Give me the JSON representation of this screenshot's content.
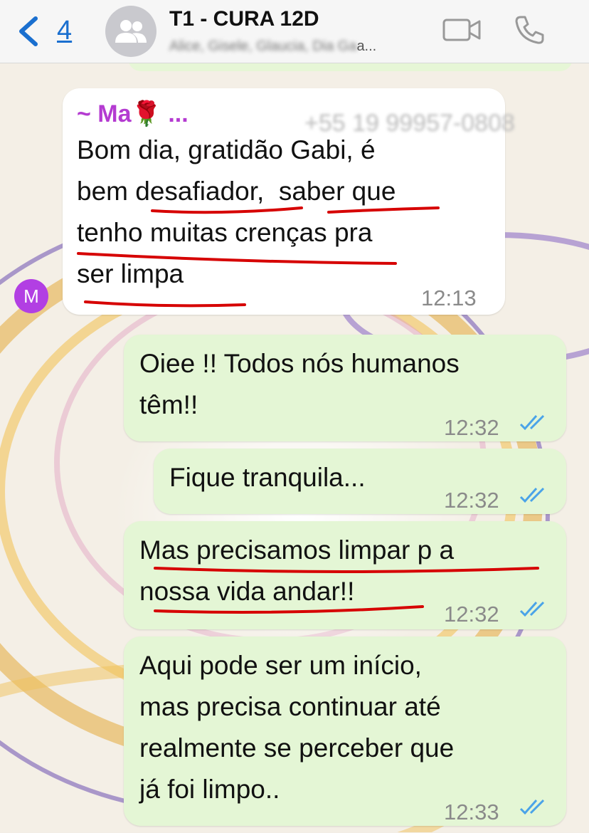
{
  "header": {
    "back_count": "4",
    "title": "T1 - CURA 12D",
    "subtitle_visible": "a...",
    "subtitle_blurred": "Alice, Gisele, Glaucia, Dia Ga"
  },
  "messages": [
    {
      "sender": "~ Ma🌹 ...",
      "sender_phone": "+55 19 99957-0808",
      "lines": [
        "Bom dia, gratidão Gabi, é",
        "bem desafiador,  saber que",
        "tenho muitas crenças pra",
        "ser limpa"
      ],
      "time": "12:13",
      "avatar_initial": "M"
    },
    {
      "lines": [
        "Oiee !! Todos nós humanos",
        "têm!!"
      ],
      "time": "12:32"
    },
    {
      "lines": [
        "Fique tranquila..."
      ],
      "time": "12:32"
    },
    {
      "lines": [
        "Mas precisamos limpar p a",
        "nossa vida andar!!"
      ],
      "time": "12:32"
    },
    {
      "lines": [
        "Aqui pode ser um início,",
        "mas precisa continuar até",
        "realmente se perceber que",
        "já foi limpo.."
      ],
      "time": "12:33"
    }
  ],
  "colors": {
    "accent_blue": "#1a6fcf",
    "sender_purple": "#b43bd1",
    "outgoing_bubble": "#e4f6d5",
    "underline_red": "#d60000",
    "read_ticks": "#4aa3e8"
  },
  "icons": [
    "chevron-left-icon",
    "group-icon",
    "video-call-icon",
    "phone-icon",
    "double-check-icon"
  ]
}
